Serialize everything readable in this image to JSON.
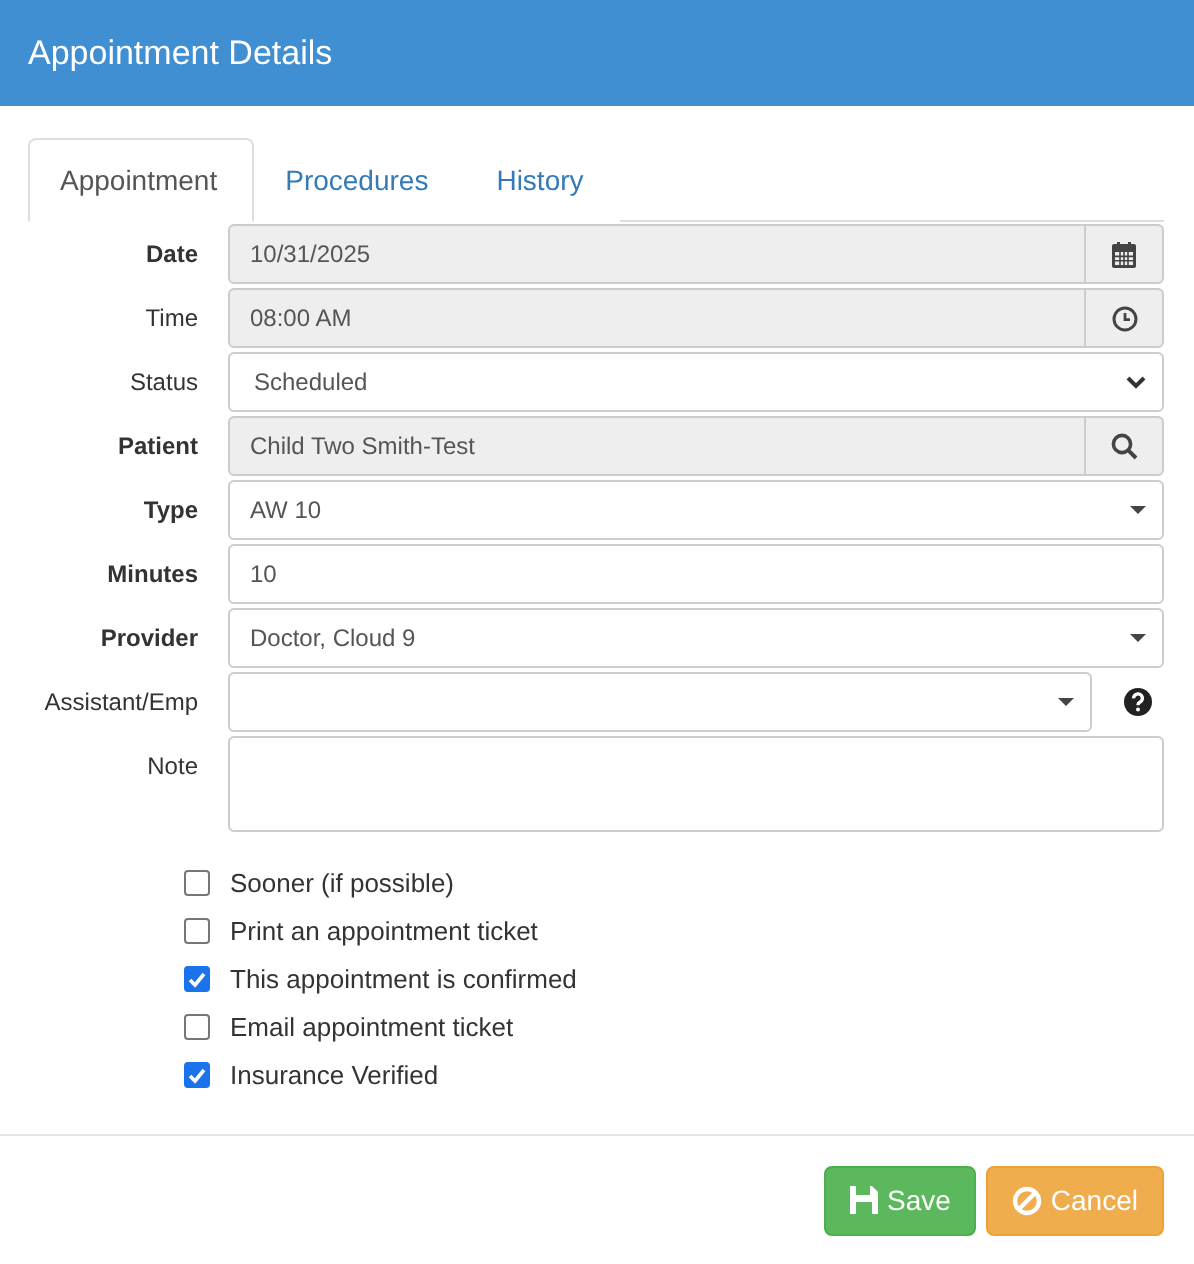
{
  "window": {
    "title": "Appointment Details"
  },
  "tabs": [
    {
      "label": "Appointment",
      "selected": true
    },
    {
      "label": "Procedures",
      "selected": false
    },
    {
      "label": "History",
      "selected": false
    }
  ],
  "fields": [
    {
      "label": "Date",
      "required": true,
      "kind": "date",
      "value": "10/31/2025"
    },
    {
      "label": "Time",
      "required": false,
      "kind": "time",
      "value": "08:00 AM"
    },
    {
      "label": "Status",
      "required": false,
      "kind": "select",
      "value": "Scheduled"
    },
    {
      "label": "Patient",
      "required": true,
      "kind": "lookup",
      "value": "Child Two Smith-Test"
    },
    {
      "label": "Type",
      "required": true,
      "kind": "combo",
      "value": "AW 10"
    },
    {
      "label": "Minutes",
      "required": true,
      "kind": "text",
      "value": "10"
    },
    {
      "label": "Provider",
      "required": true,
      "kind": "combo",
      "value": "Doctor, Cloud 9"
    },
    {
      "label": "Assistant/Emp",
      "required": false,
      "kind": "combo-help"
    },
    {
      "label": "Note",
      "required": false,
      "kind": "textarea"
    }
  ],
  "options": [
    {
      "label": "Sooner (if possible)",
      "checked": false
    },
    {
      "label": "Print an appointment ticket",
      "checked": false
    },
    {
      "label": "This appointment is confirmed",
      "checked": true
    },
    {
      "label": "Email appointment ticket",
      "checked": false
    },
    {
      "label": "Insurance Verified",
      "checked": true
    }
  ],
  "buttons": [
    {
      "label": "Save",
      "kind": "save"
    },
    {
      "label": "Cancel",
      "kind": "cancel"
    }
  ]
}
